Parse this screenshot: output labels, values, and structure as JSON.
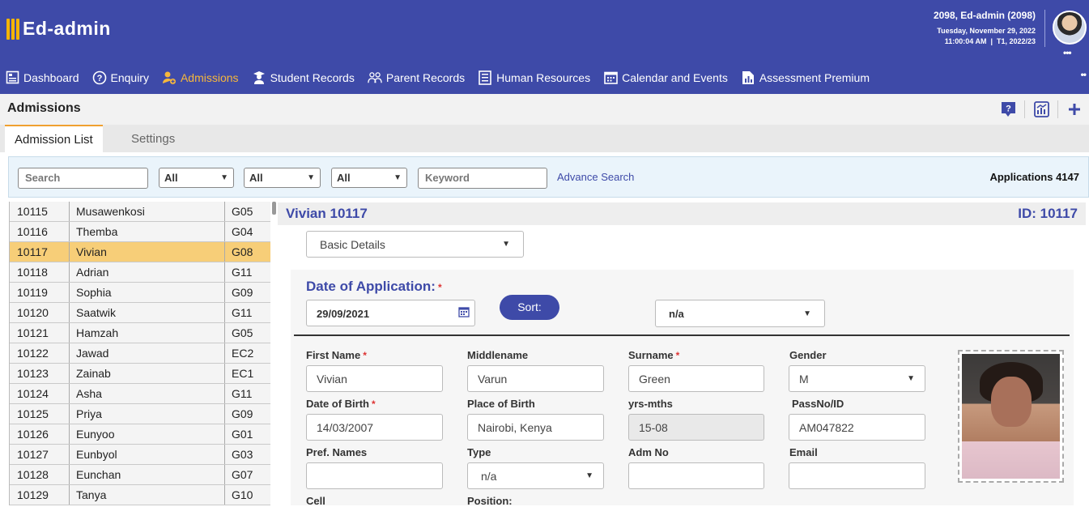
{
  "brand": {
    "name": "Ed-admin"
  },
  "user": {
    "name": "2098, Ed-admin (2098)",
    "date": "Tuesday, November 29, 2022",
    "time_term": "11:00:04 AM  |  T1, 2022/23",
    "menu_dots": "•••"
  },
  "nav": {
    "items": [
      {
        "label": "Dashboard",
        "icon": "dashboard-icon"
      },
      {
        "label": "Enquiry",
        "icon": "question-circle-icon"
      },
      {
        "label": "Admissions",
        "icon": "admission-user-icon",
        "active": true
      },
      {
        "label": "Student Records",
        "icon": "student-icon"
      },
      {
        "label": "Parent Records",
        "icon": "parents-icon"
      },
      {
        "label": "Human Resources",
        "icon": "hr-document-icon"
      },
      {
        "label": "Calendar and Events",
        "icon": "calendar-icon"
      },
      {
        "label": "Assessment Premium",
        "icon": "assessment-chart-icon"
      }
    ],
    "more": "••"
  },
  "page": {
    "title": "Admissions",
    "tabs": [
      "Admission List",
      "Settings"
    ]
  },
  "filters": {
    "search_placeholder": "Search",
    "select1": "All",
    "select2": "All",
    "select3": "All",
    "keyword_placeholder": "Keyword",
    "advance_search": "Advance Search",
    "applications": "Applications 4147"
  },
  "list": {
    "rows": [
      {
        "id": "10115",
        "name": "Musawenkosi",
        "grade": "G05"
      },
      {
        "id": "10116",
        "name": "Themba",
        "grade": "G04"
      },
      {
        "id": "10117",
        "name": "Vivian",
        "grade": "G08",
        "selected": true
      },
      {
        "id": "10118",
        "name": "Adrian",
        "grade": "G11"
      },
      {
        "id": "10119",
        "name": "Sophia",
        "grade": "G09"
      },
      {
        "id": "10120",
        "name": "Saatwik",
        "grade": "G11"
      },
      {
        "id": "10121",
        "name": "Hamzah",
        "grade": "G05"
      },
      {
        "id": "10122",
        "name": "Jawad",
        "grade": "EC2"
      },
      {
        "id": "10123",
        "name": "Zainab",
        "grade": "EC1"
      },
      {
        "id": "10124",
        "name": "Asha",
        "grade": "G11"
      },
      {
        "id": "10125",
        "name": "Priya",
        "grade": "G09"
      },
      {
        "id": "10126",
        "name": "Eunyoo",
        "grade": "G01"
      },
      {
        "id": "10127",
        "name": "Eunbyol",
        "grade": "G03"
      },
      {
        "id": "10128",
        "name": "Eunchan",
        "grade": "G07"
      },
      {
        "id": "10129",
        "name": "Tanya",
        "grade": "G10"
      }
    ]
  },
  "detail": {
    "title": "Vivian 10117",
    "id_label": "ID: 10117",
    "section": "Basic Details",
    "date_of_application_label": "Date of Application:",
    "date_of_application": "29/09/2021",
    "sort_label": "Sort:",
    "sort_value": "n/a",
    "fields": {
      "first_name_label": "First Name",
      "first_name": "Vivian",
      "middlename_label": "Middlename",
      "middlename": "Varun",
      "surname_label": "Surname",
      "surname": "Green",
      "gender_label": "Gender",
      "gender": "M",
      "dob_label": "Date of Birth",
      "dob": "14/03/2007",
      "pob_label": "Place of Birth",
      "pob": "Nairobi, Kenya",
      "yrs_mths_label": "yrs-mths",
      "yrs_mths": "15-08",
      "passno_label": "PassNo/ID",
      "passno": "AM047822",
      "pref_names_label": "Pref. Names",
      "pref_names": "",
      "type_label": "Type",
      "type": "n/a",
      "adm_no_label": "Adm No",
      "adm_no": "",
      "email_label": "Email",
      "email": "",
      "cell_label": "Cell",
      "position_label": "Position:"
    },
    "required_mark": "*"
  },
  "colors": {
    "primary": "#3e4aa8",
    "accent": "#f6b73c",
    "selected_row": "#f7ce78"
  }
}
